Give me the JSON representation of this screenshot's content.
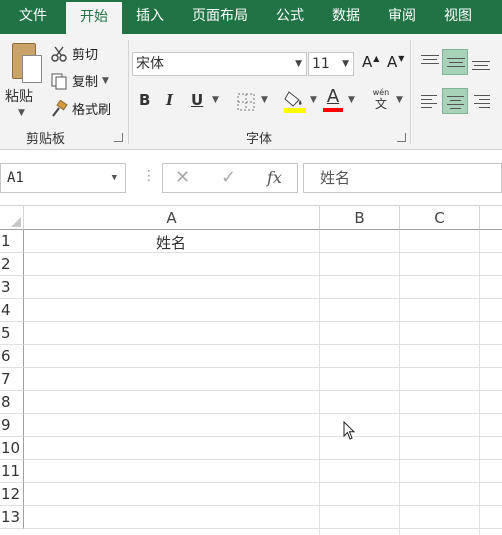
{
  "tabs": [
    "文件",
    "开始",
    "插入",
    "页面布局",
    "公式",
    "数据",
    "审阅",
    "视图"
  ],
  "clipboard": {
    "paste": "粘贴",
    "cut": "剪切",
    "copy": "复制",
    "format_painter": "格式刷",
    "group_label": "剪贴板"
  },
  "font": {
    "name": "宋体",
    "size": "11",
    "bold": "B",
    "italic": "I",
    "underline": "U",
    "color_glyph": "A",
    "grow": "A",
    "shrink": "A",
    "phonetic_top": "wén",
    "phonetic_bottom": "文",
    "group_label": "字体",
    "fill_color": "#ffff00",
    "text_color": "#ff0000"
  },
  "formula_bar": {
    "name_box": "A1",
    "cancel": "✕",
    "enter": "✓",
    "fx": "fx",
    "value": "姓名"
  },
  "sheet": {
    "columns": [
      "A",
      "B",
      "C"
    ],
    "rows": [
      "1",
      "2",
      "3",
      "4",
      "5",
      "6",
      "7",
      "8",
      "9",
      "10",
      "11",
      "12",
      "13"
    ],
    "cells": {
      "A1": "姓名"
    }
  },
  "colors": {
    "accent": "#217346",
    "ribbon_bg": "#f3f3f3",
    "selected": "#a9d3b8"
  }
}
